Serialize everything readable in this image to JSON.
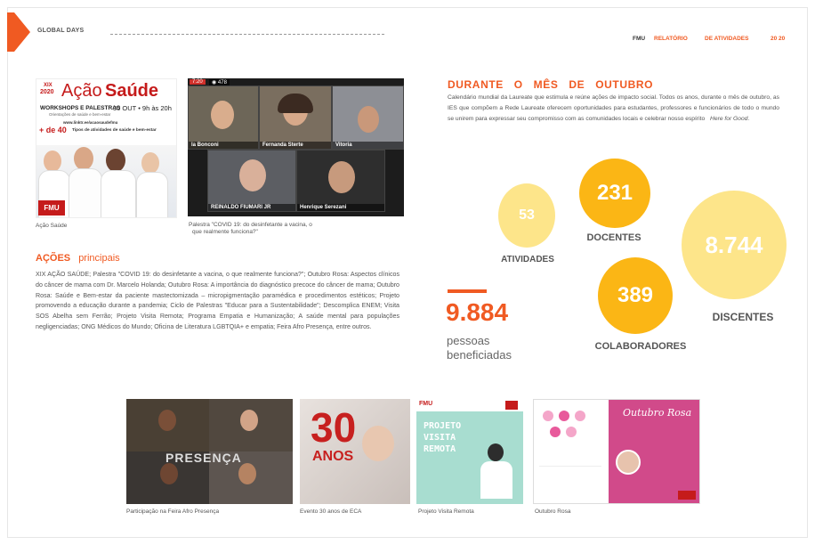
{
  "header": {
    "title": "GLOBAL DAYS",
    "brand": "FMU",
    "report_word1": "RELATÓRIO",
    "report_word2": "DE ATIVIDADES",
    "year": "20 20"
  },
  "colors": {
    "accent": "#f05a22",
    "yellow_light": "#fde58a",
    "yellow_mid": "#fdd03a",
    "yellow_deep": "#fbb615"
  },
  "poster": {
    "edition": "XIX",
    "year": "2020",
    "title_plain": "Ação",
    "title_bold": "Saúde",
    "subtitle": "WORKSHOPS E PALESTRAS",
    "date": "30 OUT • 9h às 20h",
    "tagline": "Orientações de saúde e bem-estar",
    "link": "www.linktr.ee/acaosaudefmu",
    "count": "+ de 40",
    "count_text": "Tipos de atividades de saúde e bem-estar",
    "footer_logo": "FMU"
  },
  "meeting": {
    "badge_rec": "7:20",
    "badge_views": "478",
    "tiles": [
      {
        "name": "la Bonconi"
      },
      {
        "name": "Fernanda Sterte"
      },
      {
        "name": "Vitoria"
      },
      {
        "name": "REINALDO FIUMARI JR"
      },
      {
        "name": "Henrique Serezani"
      }
    ]
  },
  "captions": {
    "poster": "Ação Saúde",
    "meeting_line1": "Palestra \"COVID 19: do desinfetante a vacina, o",
    "meeting_line2": "que realmente funciona?\""
  },
  "acoes": {
    "title_bold": "AÇÕES",
    "title_light": "principais",
    "body": "XIX AÇÃO SAÚDE; Palestra \"COVID 19: do desinfetante a vacina, o que realmente funciona?\"; Outubro Rosa: Aspectos clínicos do câncer de mama com Dr. Marcelo Holanda; Outubro Rosa: A importância do diagnóstico precoce do câncer de mama; Outubro Rosa: Saúde e Bem-estar da paciente mastectomizada – micropigmentação paramédica e procedimentos estéticos; Projeto promovendo a educação durante a pandemia; Ciclo de Palestras \"Educar para a Sustentabilidade\"; Descomplica ENEM; Visita SOS Abelha sem Ferrão; Projeto Visita Remota; Programa Empatia e Humanização; A saúde mental para populações negligenciadas; ONG Médicos do Mundo; Oficina de Literatura LGBTQIA+ e empatia; Feira Afro Presença, entre outros."
  },
  "durante": {
    "title": "DURANTE O MÊS DE OUTUBRO",
    "body_pre": "Calendário mundial da Laureate que estimula e reúne ações de impacto social. Todos os anos, durante o mês de outubro, as IES que compõem a Rede Laureate oferecem oportunidades para estudantes, professores e funcionários de todo o mundo se unirem para expressar seu compromisso com as comunidades locais e celebrar nosso espírito",
    "body_italic": "Here for Good",
    "body_post": "."
  },
  "stats": {
    "atividades": {
      "value": "53",
      "label": "ATIVIDADES"
    },
    "docentes": {
      "value": "231",
      "label": "DOCENTES"
    },
    "discentes": {
      "value": "8.744",
      "label": "DISCENTES"
    },
    "colaboradores": {
      "value": "389",
      "label": "COLABORADORES"
    },
    "beneficiadas": {
      "value": "9.884",
      "label_line1": "pessoas",
      "label_line2": "beneficiadas"
    }
  },
  "gallery": [
    {
      "caption": "Participação na Feira Afro Presença",
      "overlay": "PRESENÇA"
    },
    {
      "caption": "Evento 30 anos de ECA",
      "overlay_big": "30",
      "overlay_small": "ANOS"
    },
    {
      "caption": "Projeto Visita Remota",
      "overlay": "PROJETO VISITA REMOTA",
      "logo": "FMU"
    },
    {
      "caption": "Outubro Rosa",
      "overlay": "Outubro Rosa"
    }
  ]
}
